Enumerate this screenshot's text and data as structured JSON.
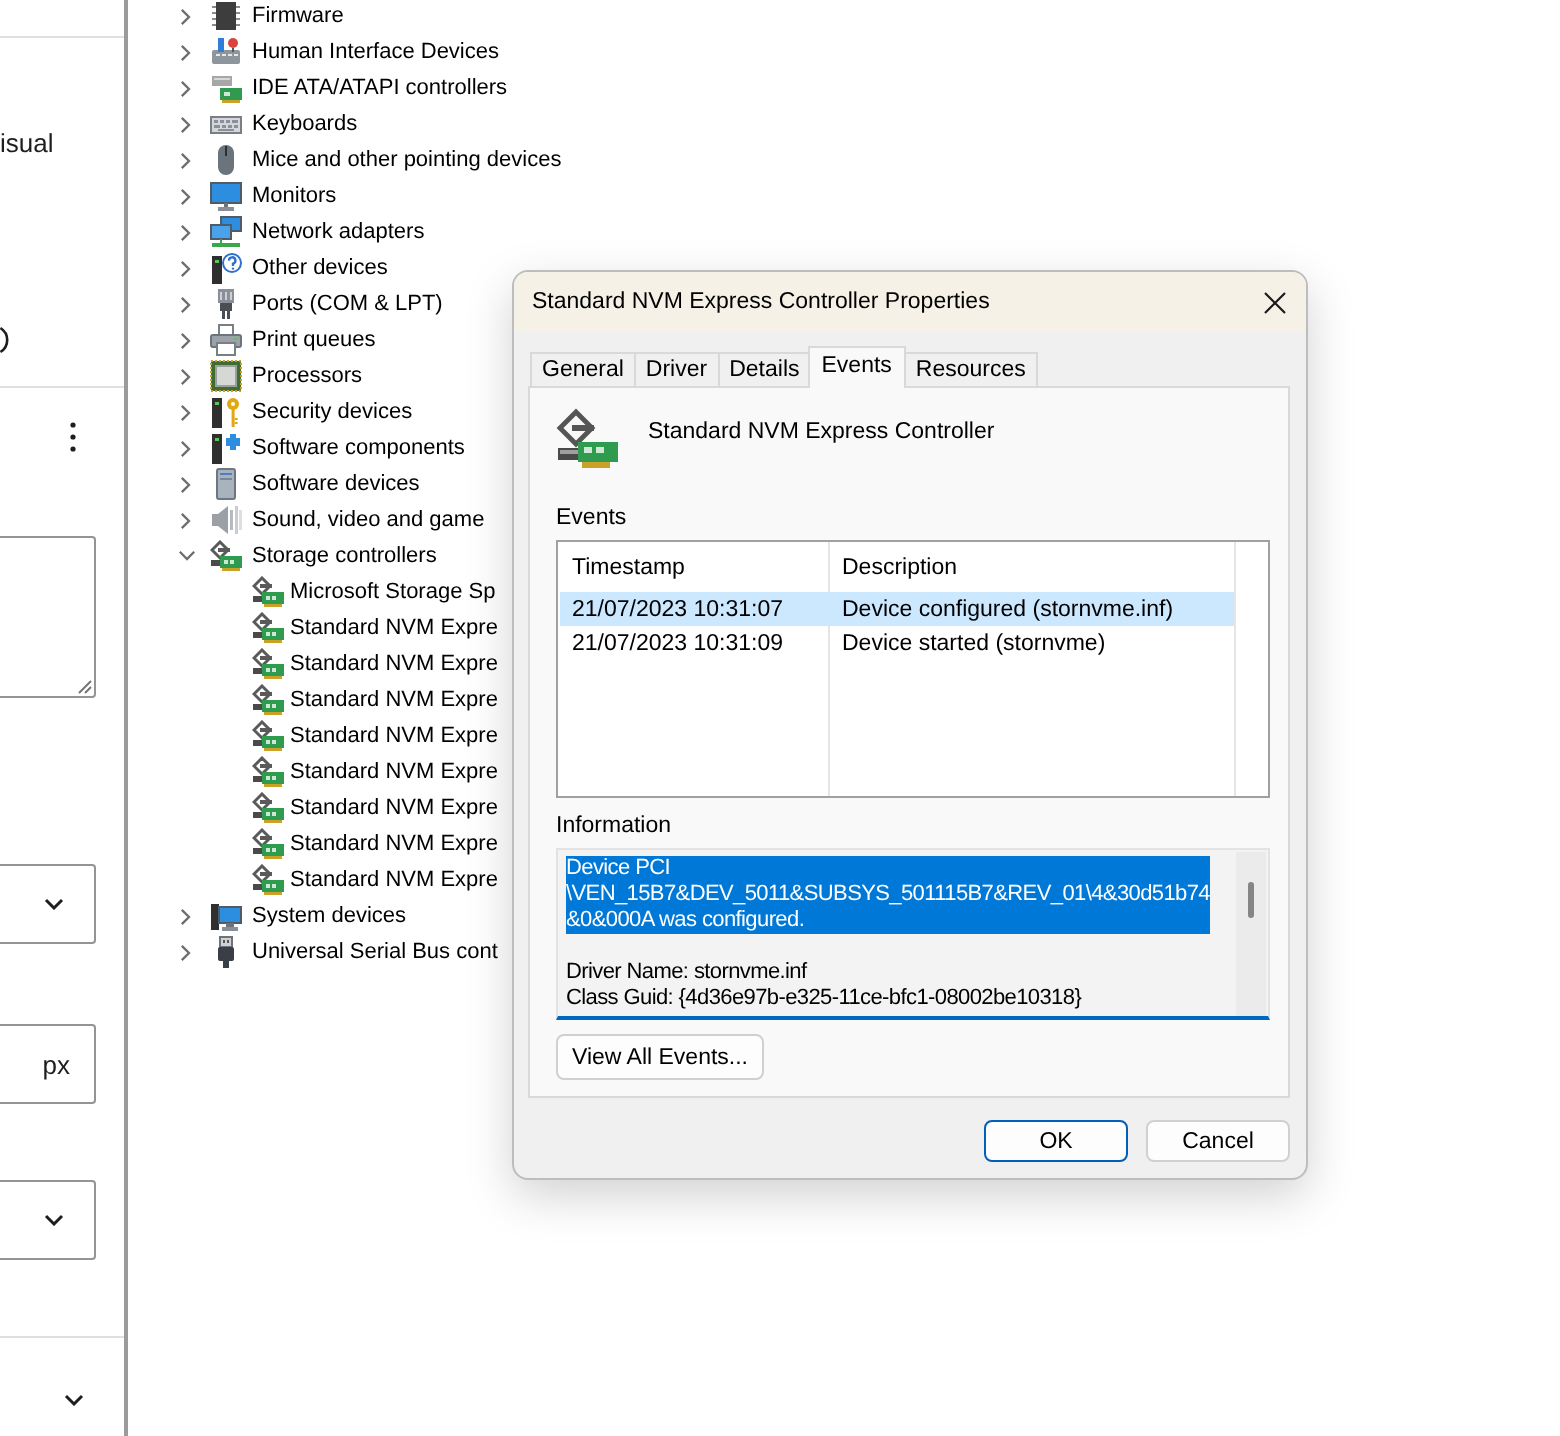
{
  "settings_panel": {
    "label": "isual",
    "fields": [
      {
        "kind": "textarea"
      },
      {
        "kind": "select"
      },
      {
        "kind": "unit-input",
        "unit": "px"
      },
      {
        "kind": "select"
      }
    ]
  },
  "device_tree": {
    "items": [
      {
        "label": "Firmware",
        "expanded": false
      },
      {
        "label": "Human Interface Devices",
        "expanded": false
      },
      {
        "label": "IDE ATA/ATAPI controllers",
        "expanded": false
      },
      {
        "label": "Keyboards",
        "expanded": false
      },
      {
        "label": "Mice and other pointing devices",
        "expanded": false
      },
      {
        "label": "Monitors",
        "expanded": false
      },
      {
        "label": "Network adapters",
        "expanded": false
      },
      {
        "label": "Other devices",
        "expanded": false
      },
      {
        "label": "Ports (COM & LPT)",
        "expanded": false
      },
      {
        "label": "Print queues",
        "expanded": false
      },
      {
        "label": "Processors",
        "expanded": false
      },
      {
        "label": "Security devices",
        "expanded": false
      },
      {
        "label": "Software components",
        "expanded": false
      },
      {
        "label": "Software devices",
        "expanded": false
      },
      {
        "label": "Sound, video and game",
        "expanded": false
      },
      {
        "label": "Storage controllers",
        "expanded": true,
        "children": [
          {
            "label": "Microsoft Storage Sp"
          },
          {
            "label": "Standard NVM Expre"
          },
          {
            "label": "Standard NVM Expre"
          },
          {
            "label": "Standard NVM Expre"
          },
          {
            "label": "Standard NVM Expre"
          },
          {
            "label": "Standard NVM Expre"
          },
          {
            "label": "Standard NVM Expre"
          },
          {
            "label": "Standard NVM Expre"
          },
          {
            "label": "Standard NVM Expre"
          }
        ]
      },
      {
        "label": "System devices",
        "expanded": false
      },
      {
        "label": "Universal Serial Bus cont",
        "expanded": false
      }
    ]
  },
  "dialog": {
    "title": "Standard NVM Express Controller Properties",
    "tabs": [
      {
        "label": "General",
        "selected": false
      },
      {
        "label": "Driver",
        "selected": false
      },
      {
        "label": "Details",
        "selected": false
      },
      {
        "label": "Events",
        "selected": true
      },
      {
        "label": "Resources",
        "selected": false
      }
    ],
    "device_name": "Standard NVM Express Controller",
    "events": {
      "label": "Events",
      "columns": [
        "Timestamp",
        "Description"
      ],
      "rows": [
        {
          "timestamp": "21/07/2023 10:31:07",
          "description": "Device configured (stornvme.inf)",
          "selected": true
        },
        {
          "timestamp": "21/07/2023 10:31:09",
          "description": "Device started (stornvme)",
          "selected": false
        }
      ]
    },
    "information": {
      "label": "Information",
      "paragraphs": [
        {
          "text": "Device PCI\n\\VEN_15B7&DEV_5011&SUBSYS_501115B7&REV_01\\4&30d51b74\n&0&000A was configured.",
          "selected": true
        },
        {
          "text": "Driver Name: stornvme.inf\nClass Guid: {4d36e97b-e325-11ce-bfc1-08002be10318}",
          "selected": false
        }
      ]
    },
    "view_all_button": "View All Events...",
    "buttons": [
      {
        "label": "OK",
        "default": true
      },
      {
        "label": "Cancel",
        "default": false
      }
    ]
  }
}
